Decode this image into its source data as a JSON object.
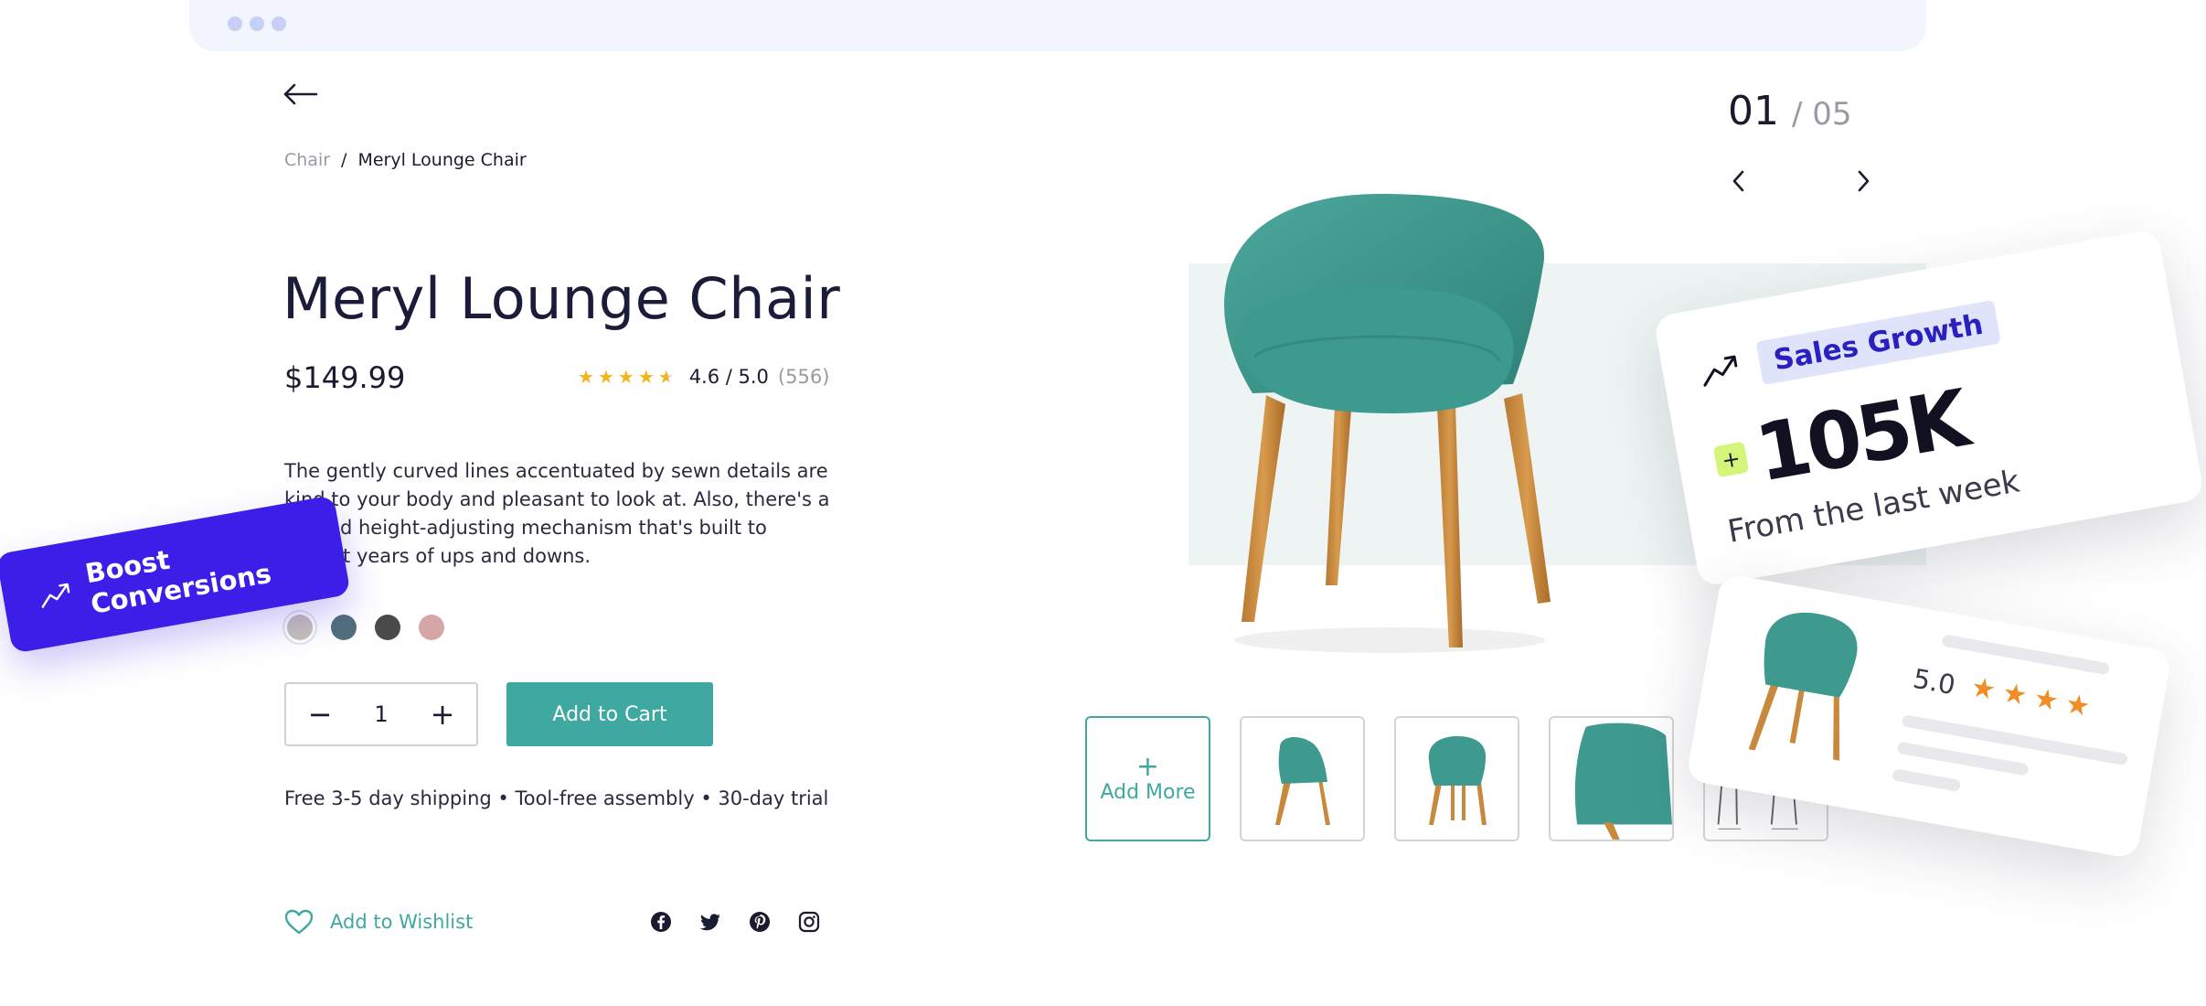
{
  "breadcrumb": {
    "parent": "Chair",
    "separator": "/",
    "current": "Meryl Lounge Chair"
  },
  "product": {
    "title": "Meryl Lounge Chair",
    "price": "$149.99",
    "rating_text": "4.6 / 5.0",
    "rating_count": "(556)",
    "rating_value": 4.6,
    "rating_max": 5,
    "description": "The gently curved lines accentuated by sewn details are kind to your body and pleasant to look at. Also, there's a tilt and height-adjusting mechanism that's built to outlast years of ups and downs.",
    "swatches": [
      "#c8c1b8",
      "#52707a",
      "#4a4a4a",
      "#d5a6a6"
    ],
    "selected_swatch": 0,
    "quantity": "1",
    "add_to_cart": "Add to Cart",
    "shipping": "Free 3-5 day shipping  •  Tool-free assembly  •  30-day trial",
    "wishlist": "Add to Wishlist",
    "socials": [
      "facebook-icon",
      "twitter-icon",
      "pinterest-icon",
      "instagram-icon"
    ]
  },
  "boost": {
    "label": "Boost Conversions",
    "color": "#3b1ee8"
  },
  "gallery": {
    "current": "01",
    "total": "/ 05",
    "add_more": "Add More",
    "accent": "#3fa8a0"
  },
  "sales_card": {
    "badge": "Sales Growth",
    "plus": "+",
    "value": "105K",
    "subtitle": "From the last week"
  },
  "review_card": {
    "score": "5.0",
    "stars": 4
  }
}
